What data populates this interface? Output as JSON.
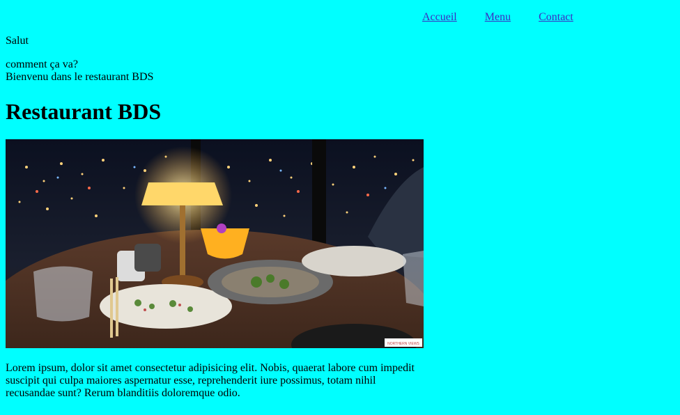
{
  "nav": {
    "items": [
      {
        "label": "Accueil"
      },
      {
        "label": "Menu"
      },
      {
        "label": "Contact"
      }
    ]
  },
  "greeting": "Salut",
  "subtitle_line1": "comment ça va?",
  "subtitle_line2": "Bienvenu dans le restaurant BDS",
  "heading": "Restaurant BDS",
  "image": {
    "alt": "Restaurant BDS",
    "watermark_text": "NORTHERN VIEWS"
  },
  "paragraph": "Lorem ipsum, dolor sit amet consectetur adipisicing elit. Nobis, quaerat labore cum impedit suscipit qui culpa maiores aspernatur esse, reprehenderit iure possimus, totam nihil recusandae sunt? Rerum blanditiis doloremque odio.",
  "colors": {
    "background": "#00ffff",
    "link": "#3a2fc0"
  }
}
